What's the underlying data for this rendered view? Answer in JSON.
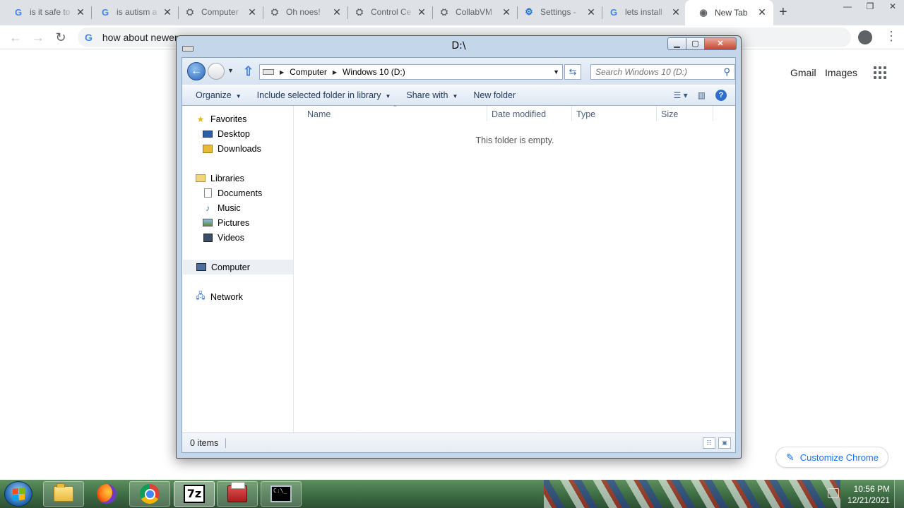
{
  "chrome": {
    "tabs": [
      {
        "title": "is it safe to",
        "favicon": "google-g-icon"
      },
      {
        "title": "is autism a",
        "favicon": "google-g-icon"
      },
      {
        "title": "Computer",
        "favicon": "collabvm-icon"
      },
      {
        "title": "Oh noes!",
        "favicon": "collabvm-icon"
      },
      {
        "title": "Control Ce",
        "favicon": "collabvm-icon"
      },
      {
        "title": "CollabVM",
        "favicon": "collabvm-icon"
      },
      {
        "title": "Settings -",
        "favicon": "gear-icon"
      },
      {
        "title": "lets install",
        "favicon": "google-g-icon"
      },
      {
        "title": "New Tab",
        "favicon": "chrome-icon"
      }
    ],
    "close_glyph": "✕",
    "new_tab_glyph": "+",
    "omnibox_text": "how about newer",
    "win_min": "—",
    "win_max": "❐",
    "win_close": "✕"
  },
  "ntp": {
    "gmail": "Gmail",
    "images": "Images",
    "customize": "Customize Chrome"
  },
  "explorer": {
    "title": "D:\\",
    "breadcrumb": [
      "Computer",
      "Windows 10 (D:)"
    ],
    "search_placeholder": "Search Windows 10 (D:)",
    "commands": [
      "Organize",
      "Include selected folder in library",
      "Share with",
      "New folder"
    ],
    "nav": {
      "favorites": "Favorites",
      "desktop": "Desktop",
      "downloads": "Downloads",
      "libraries": "Libraries",
      "documents": "Documents",
      "music": "Music",
      "pictures": "Pictures",
      "videos": "Videos",
      "computer": "Computer",
      "network": "Network"
    },
    "columns": [
      "Name",
      "Date modified",
      "Type",
      "Size"
    ],
    "empty_text": "This folder is empty.",
    "status": "0 items"
  },
  "taskbar": {
    "buttons": [
      "windows-explorer",
      "firefox",
      "chrome",
      "7-zip",
      "toolbox",
      "command-prompt"
    ],
    "seven_zip_label": "7z",
    "cmd_label": "C:\\_",
    "time": "10:56 PM",
    "date": "12/21/2021"
  }
}
